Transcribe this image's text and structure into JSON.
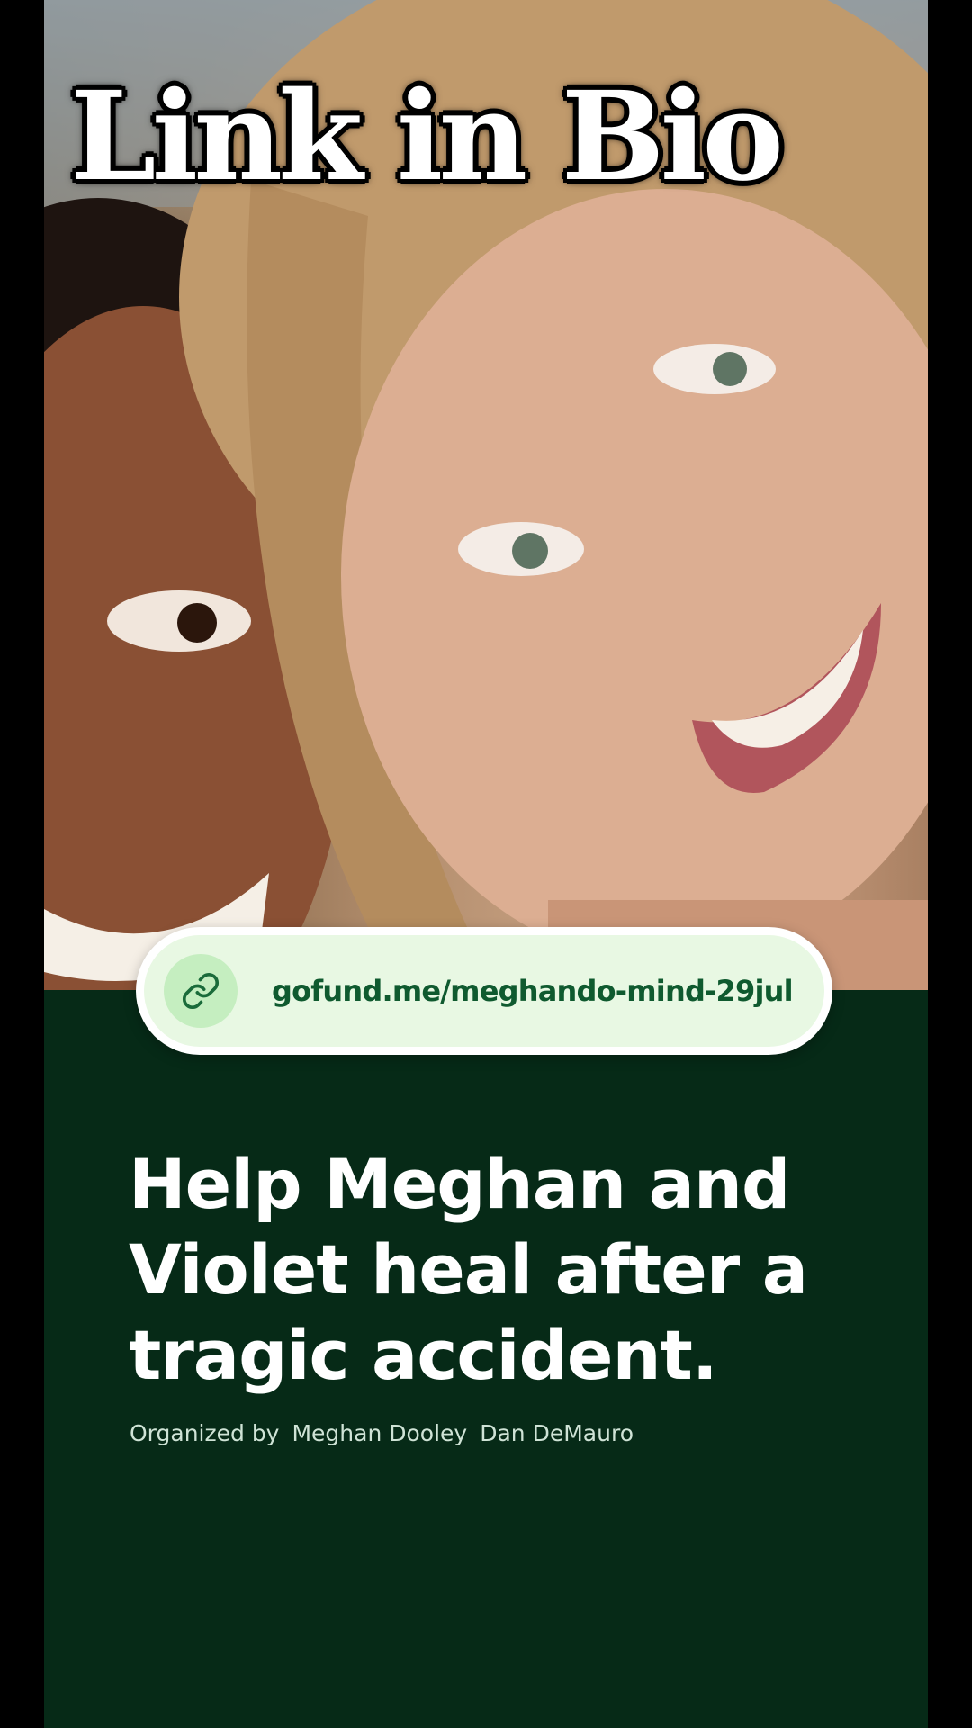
{
  "overlay": {
    "headline": "Link in Bio"
  },
  "campaign": {
    "link_icon": "link-icon",
    "link_url": "gofund.me/meghando-mind-29jul",
    "title": "Help Meghan and Violet heal after a tragic accident.",
    "organized_by_prefix": "Organized by",
    "organizers": [
      "Meghan Dooley",
      "Dan DeMauro"
    ]
  },
  "colors": {
    "page_background": "#062a17",
    "pill_background": "#e8f8e3",
    "link_text": "#0f5a2f",
    "icon_circle": "#c5eec0",
    "side_bars": "#000000"
  }
}
